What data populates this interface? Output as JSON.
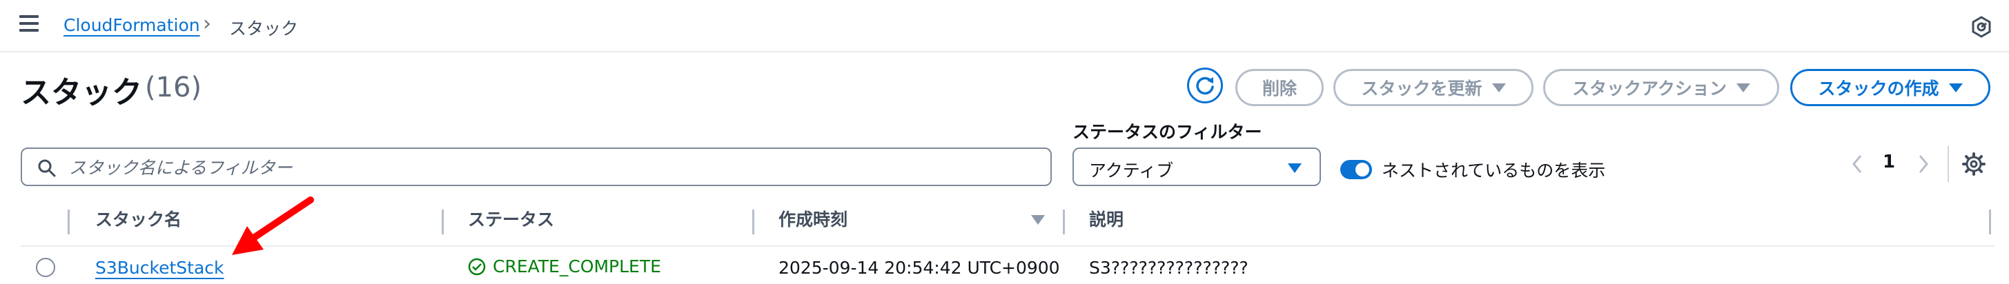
{
  "header": {
    "breadcrumb_service": "CloudFormation",
    "breadcrumb_current": "スタック",
    "icons": [
      "menu-icon",
      "help-icon"
    ]
  },
  "page": {
    "title": "スタック",
    "count": "(16)"
  },
  "actions": {
    "delete": "削除",
    "update": "スタックを更新",
    "stack_actions": "スタックアクション",
    "create": "スタックの作成"
  },
  "filters": {
    "search_placeholder": "スタック名によるフィルター",
    "status_label": "ステータスのフィルター",
    "status_value": "アクティブ",
    "nested_toggle_label": "ネストされているものを表示",
    "nested_toggle_on": true
  },
  "pagination": {
    "current_page": "1"
  },
  "table": {
    "columns": [
      "スタック名",
      "ステータス",
      "作成時刻",
      "説明"
    ],
    "rows": [
      {
        "name": "S3BucketStack",
        "status": "CREATE_COMPLETE",
        "created": "2025-09-14 20:54:42 UTC+0900",
        "description": "S3???????????????"
      }
    ]
  },
  "colors": {
    "link": "#0972d3",
    "success": "#037f0c",
    "annotation_arrow": "#ff0000"
  }
}
